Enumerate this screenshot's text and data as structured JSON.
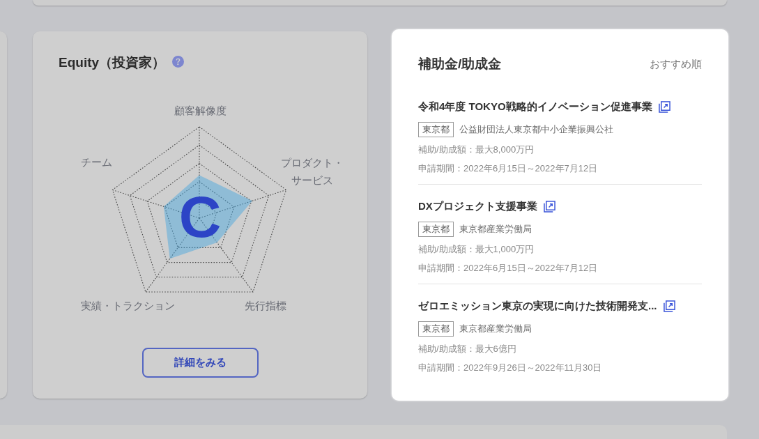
{
  "equity_card": {
    "title": "Equity（投資家）",
    "radar": {
      "axes": [
        "顧客解像度",
        "チーム",
        "プロダクト・サービス",
        "実績・トラクション",
        "先行指標"
      ],
      "grade": "C"
    },
    "button": "詳細をみる"
  },
  "grants_card": {
    "title": "補助金/助成金",
    "sort": "おすすめ順",
    "items": [
      {
        "title": "令和4年度 TOKYO戦略的イノベーション促進事業",
        "region": "東京都",
        "organization": "公益財団法人東京都中小企業振興公社",
        "amount": "補助/助成額：最大8,000万円",
        "period": "申請期間：2022年6月15日～2022年7月12日"
      },
      {
        "title": "DXプロジェクト支援事業",
        "region": "東京都",
        "organization": "東京都産業労働局",
        "amount": "補助/助成額：最大1,000万円",
        "period": "申請期間：2022年6月15日～2022年7月12日"
      },
      {
        "title": "ゼロエミッション東京の実現に向けた技術開発支...",
        "region": "東京都",
        "organization": "東京都産業労働局",
        "amount": "補助/助成額：最大6億円",
        "period": "申請期間：2022年9月26日～2022年11月30日"
      }
    ]
  }
}
